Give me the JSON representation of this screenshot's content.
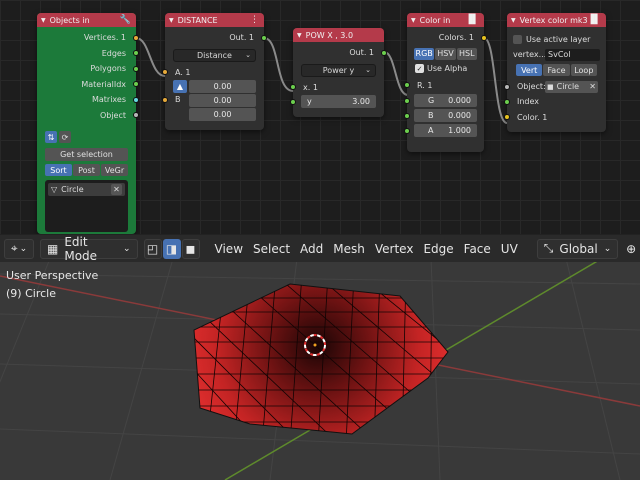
{
  "node_objects_in": {
    "title": "Objects in",
    "outputs": [
      "Vertices. 1",
      "Edges",
      "Polygons",
      "MaterialIdx",
      "Matrixes",
      "Object"
    ],
    "get_selection": "Get selection",
    "sort_buttons": [
      "Sort",
      "Post",
      "VeGr"
    ],
    "object_item": "Circle"
  },
  "node_distance": {
    "title": "DISTANCE",
    "output": "Out. 1",
    "mode": "Distance",
    "input_a": "A. 1",
    "input_b": "B",
    "values": [
      "0.00",
      "0.00",
      "0.00"
    ]
  },
  "node_pow": {
    "title": "POW X ,  3.0",
    "output": "Out. 1",
    "mode": "Power y",
    "input_x": "x. 1",
    "y_label": "y",
    "y_value": "3.00"
  },
  "node_color_in": {
    "title": "Color in",
    "output": "Colors. 1",
    "modes": [
      "RGB",
      "HSV",
      "HSL"
    ],
    "use_alpha": "Use Alpha",
    "input_r": "R. 1",
    "channels": [
      {
        "label": "G",
        "value": "0.000"
      },
      {
        "label": "B",
        "value": "0.000"
      },
      {
        "label": "A",
        "value": "1.000"
      }
    ]
  },
  "node_vertex_color": {
    "title": "Vertex color mk3",
    "use_active_layer": "Use active layer",
    "vertex_label": "vertex...",
    "vertex_value": "SvCol",
    "modes": [
      "Vert",
      "Face",
      "Loop"
    ],
    "object_label": "Object:",
    "object_value": "Circle",
    "input_index": "Index",
    "input_color": "Color. 1"
  },
  "viewport_header": {
    "mode": "Edit Mode",
    "menus": [
      "View",
      "Select",
      "Add",
      "Mesh",
      "Vertex",
      "Edge",
      "Face",
      "UV"
    ],
    "orientation": "Global"
  },
  "viewport": {
    "perspective_label": "User Perspective",
    "object_label": "(9) Circle"
  },
  "colors": {
    "node_header": "#b43a4a",
    "node_body": "#303030",
    "objects_in_body": "#1c7a3a",
    "active_blue": "#4772b3",
    "mesh_red": "#d42a2a"
  }
}
